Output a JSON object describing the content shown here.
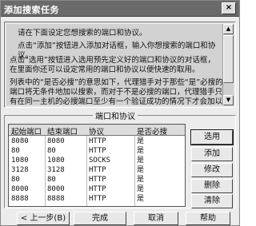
{
  "window": {
    "title": "添加搜索任务",
    "close_glyph": "×"
  },
  "instructions": {
    "p1": "请在下面设定您想搜索的端口和协议。",
    "p2": "点击“添加”按钮进入添加对话框，输入你想搜索的端口和协议。",
    "p3": "点击“选用”按钮进入选用预先定义好的端口和协议的对话框，在里面你还可以设定常用的端口和协议以便快速的取用。",
    "p4": "列表中的“是否必搜”的意思如下，代理猎手对于那些“是”必搜的端口将无条件地加以搜索，而对于不是必搜的端口，代理猎手只有在同一主机的必搜端口至少有一个验证成功的情况下才会加以搜索，此选项对于搜索HTTP等较少开放的代理服务很有用，一般的"
  },
  "ports_group": {
    "label": "端口和协议",
    "columns": [
      "起始端口",
      "结束端口",
      "协议",
      "是否必搜"
    ],
    "rows": [
      [
        "8080",
        "8080",
        "HTTP",
        "是"
      ],
      [
        "80",
        "80",
        "HTTP",
        "是"
      ],
      [
        "1080",
        "1080",
        "SOCKS",
        "是"
      ],
      [
        "3128",
        "3128",
        "HTTP",
        "是"
      ],
      [
        "80",
        "80",
        "HTTP",
        "是"
      ],
      [
        "8000",
        "8000",
        "HTTP",
        "是"
      ],
      [
        "8888",
        "8888",
        "HTTP",
        "是"
      ]
    ]
  },
  "side_buttons": {
    "select": "选用",
    "add": "添加",
    "edit": "修改",
    "delete": "删除",
    "clear": "清除"
  },
  "bottom_buttons": {
    "back": "< 上一步(B)",
    "finish": "完成",
    "cancel": "取消",
    "help": "帮助"
  }
}
